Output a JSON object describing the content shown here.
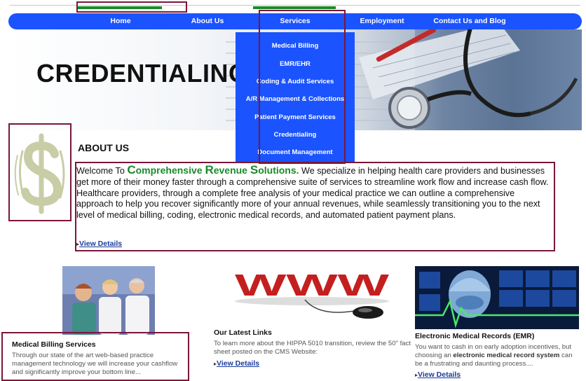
{
  "nav": {
    "items": [
      "Home",
      "About Us",
      "Services",
      "Employment",
      "Contact Us and Blog"
    ]
  },
  "hero": {
    "title": "CREDENTIALING"
  },
  "services_menu": {
    "items": [
      "Medical Billing",
      "EMR/EHR",
      "Coding & Audit Services",
      "A/R Management & Collections",
      "Patient Payment Services",
      "Credentialing",
      "Document Management"
    ]
  },
  "about": {
    "title": "ABOUT US",
    "welcome_prefix": "Welcome To ",
    "company_c1": "C",
    "company_w1": "omprehensive ",
    "company_c2": "R",
    "company_w2": "evenue ",
    "company_c3": "S",
    "company_w3": "olutions.",
    "body": "  We specialize in helping health care providers and businesses get more of their money faster through a comprehensive suite of services to streamline work flow and increase cash flow. Healthcare providers, through a complete free analysis of your medical practice we can outline a comprehensive approach to help you recover significantly more of your annual revenues, while seamlessly transitioning you to the next level of medical billing, coding, electronic medical records, and automated patient payment plans.",
    "link": "View Details"
  },
  "columns": {
    "billing": {
      "title": "Medical Billing Services",
      "text": "Through our state of the art web-based practice management technology we will increase your cashflow and significantly improve your bottom line..."
    },
    "links": {
      "title": "Our Latest Links",
      "text": "To learn more about the HIPPA 5010 transition, review the 50\" fact sheet posted on the CMS Website:",
      "link": "View Details",
      "banner": "WWW"
    },
    "emr": {
      "title": "Electronic Medical Records (EMR)",
      "text_a": "You want to cash in on early adoption incentives, but choosing an ",
      "text_bold": "electronic medical record system",
      "text_b": " can be a frustrating and daunting process....",
      "link": "View Details"
    }
  },
  "colors": {
    "nav_blue": "#1b53ff",
    "brand_green": "#1a8a2a",
    "outline": "#7a1737"
  }
}
